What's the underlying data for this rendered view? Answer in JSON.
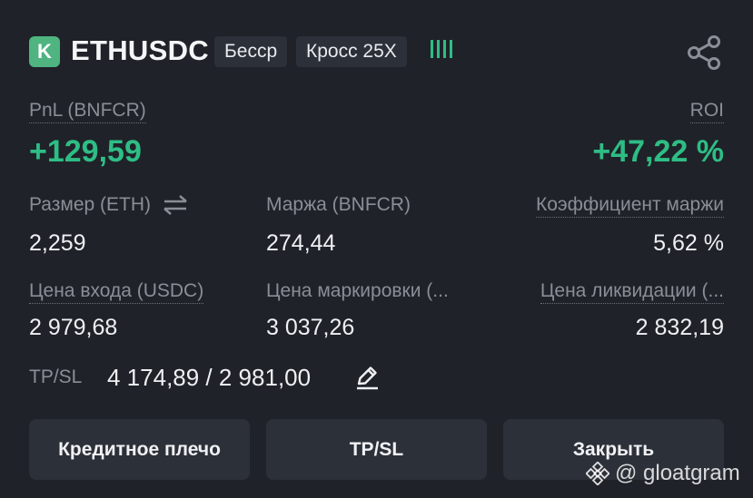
{
  "header": {
    "badge": "K",
    "symbol": "ETHUSDC",
    "margin_mode": "Бесср",
    "leverage": "Кросс 25X",
    "share_icon": "share-icon"
  },
  "pnl": {
    "label": "PnL (BNFCR)",
    "value": "+129,59"
  },
  "roi": {
    "label": "ROI",
    "value": "+47,22 %"
  },
  "stats": {
    "size_label": "Размер (ETH)",
    "size_value": "2,259",
    "margin_label": "Маржа (BNFCR)",
    "margin_value": "274,44",
    "margin_ratio_label": "Коэффициент маржи",
    "margin_ratio_value": "5,62 %",
    "entry_label": "Цена входа (USDC)",
    "entry_value": "2 979,68",
    "mark_label": "Цена маркировки (...",
    "mark_value": "3 037,26",
    "liq_label": "Цена ликвидации (...",
    "liq_value": "2 832,19"
  },
  "tpsl": {
    "label": "TP/SL",
    "value": "4 174,89 / 2 981,00"
  },
  "buttons": {
    "leverage": "Кредитное плечо",
    "tpsl": "TP/SL",
    "close": "Закрыть"
  },
  "watermark": {
    "text": "@ gloatgram"
  },
  "colors": {
    "positive": "#2ebd85",
    "background": "#1f2228",
    "button": "#2c3038"
  }
}
